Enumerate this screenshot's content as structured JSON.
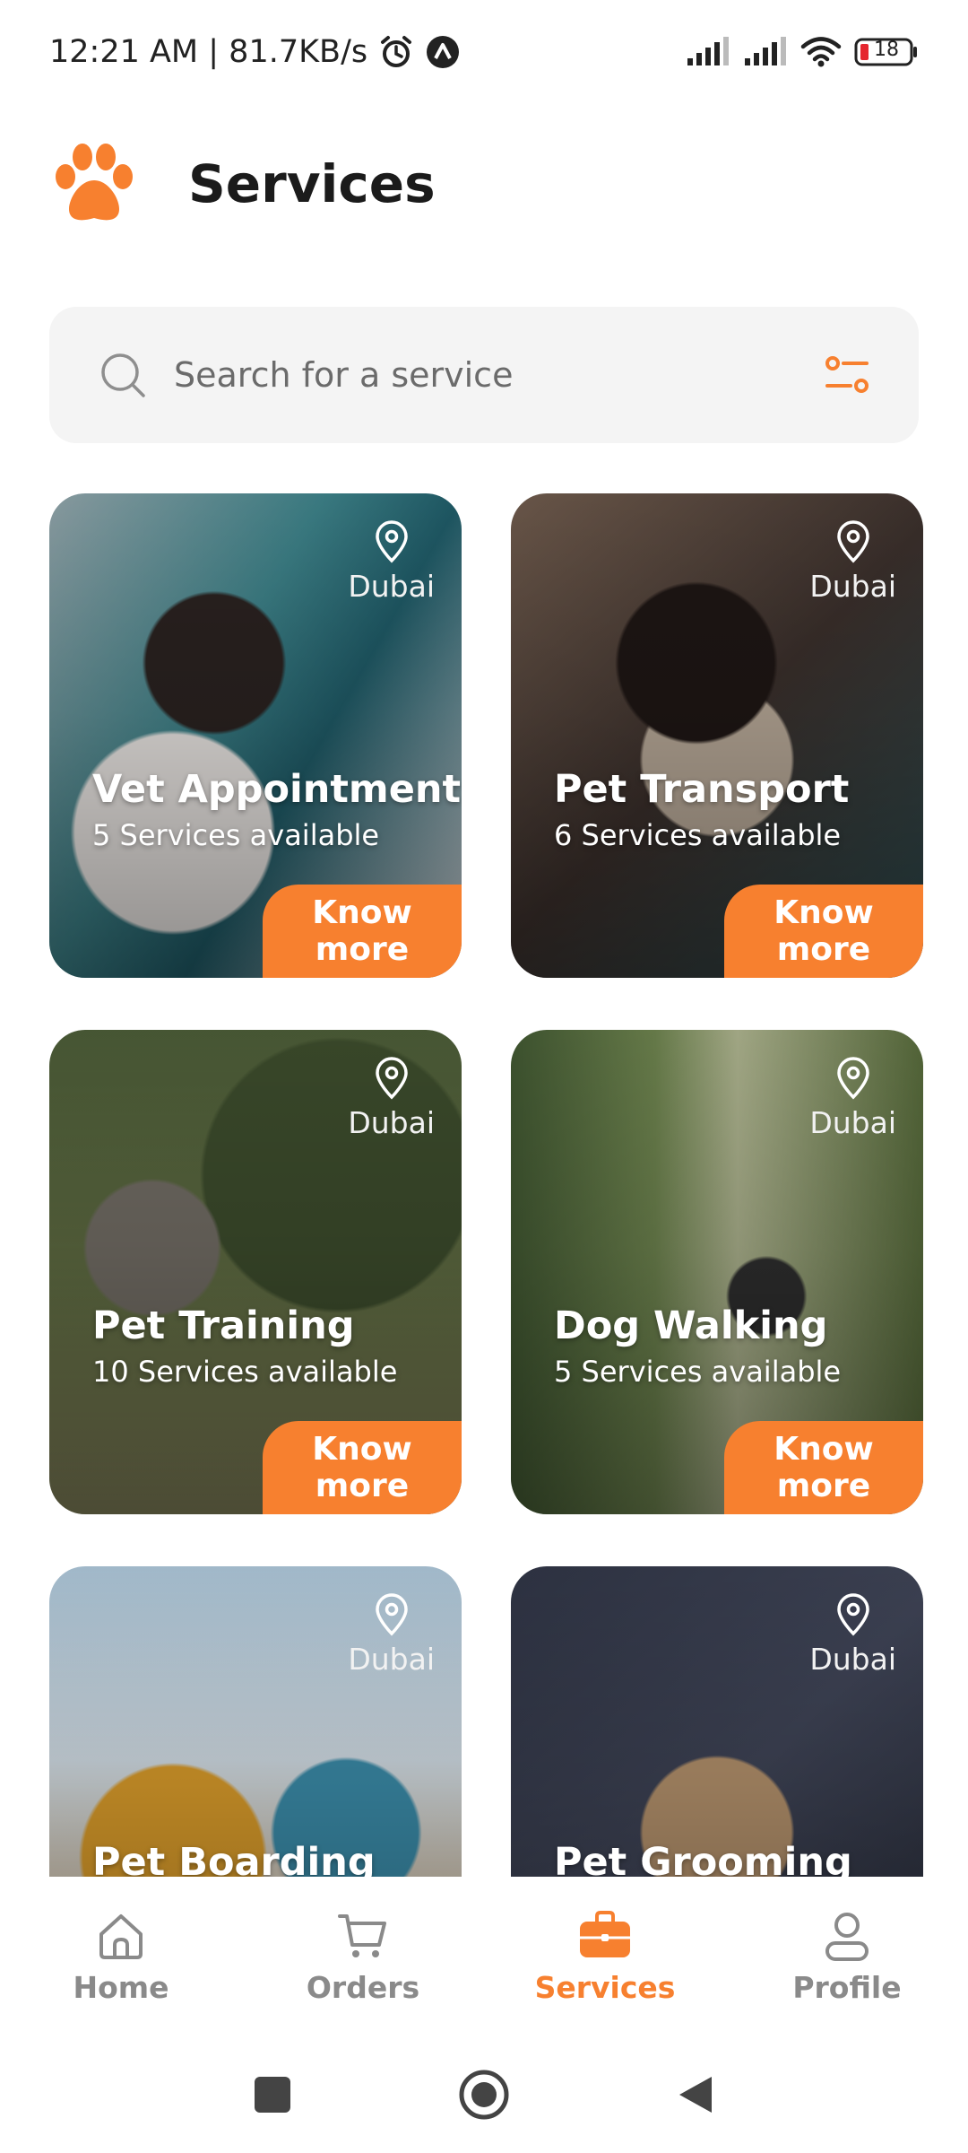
{
  "status_bar": {
    "time": "12:21 AM | 81.7KB/s",
    "battery": "18"
  },
  "header": {
    "title": "Services",
    "logo_icon": "paw-icon"
  },
  "search": {
    "placeholder": "Search for a service",
    "value": ""
  },
  "colors": {
    "accent": "#f7802f",
    "search_bg": "#f4f4f4",
    "inactive_nav": "#8a8a8a"
  },
  "cards": [
    {
      "title": "Vet Appointment",
      "subtitle": "5 Services available",
      "location": "Dubai",
      "button": "Know more"
    },
    {
      "title": "Pet Transport",
      "subtitle": "6 Services available",
      "location": "Dubai",
      "button": "Know more"
    },
    {
      "title": "Pet Training",
      "subtitle": "10 Services available",
      "location": "Dubai",
      "button": "Know more"
    },
    {
      "title": "Dog Walking",
      "subtitle": "5 Services available",
      "location": "Dubai",
      "button": "Know more"
    },
    {
      "title": "Pet Boarding",
      "subtitle": "",
      "location": "Dubai",
      "button": ""
    },
    {
      "title": "Pet Grooming",
      "subtitle": "",
      "location": "Dubai",
      "button": ""
    }
  ],
  "bottom_nav": {
    "items": [
      {
        "label": "Home",
        "icon": "home-icon",
        "active": false
      },
      {
        "label": "Orders",
        "icon": "cart-icon",
        "active": false
      },
      {
        "label": "Services",
        "icon": "briefcase-icon",
        "active": true
      },
      {
        "label": "Profile",
        "icon": "user-icon",
        "active": false
      }
    ]
  }
}
